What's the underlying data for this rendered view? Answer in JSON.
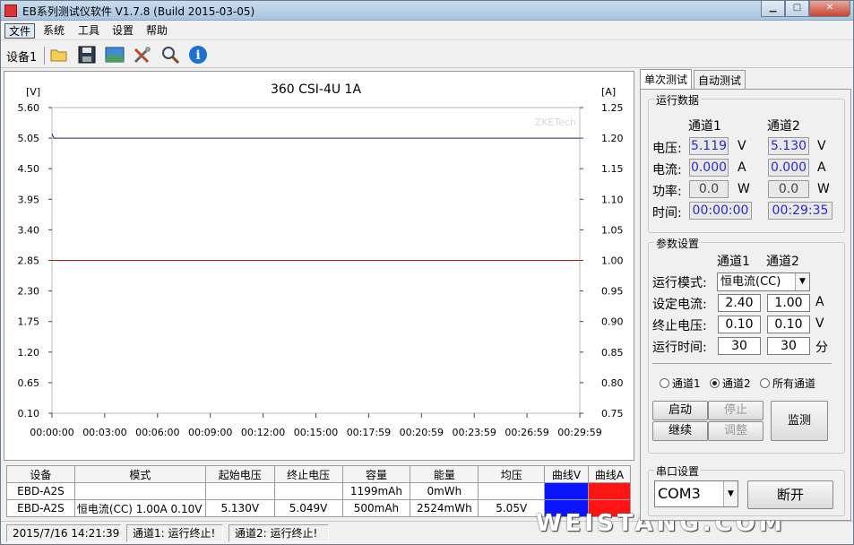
{
  "window": {
    "title": "EB系列测试仪软件 V1.7.8 (Build 2015-03-05)",
    "min_label": "▁",
    "max_label": "□",
    "close_label": "✕"
  },
  "menu": [
    "文件",
    "系统",
    "工具",
    "设置",
    "帮助"
  ],
  "toolbar": {
    "device_tab": "设备1",
    "icons": [
      "folder-icon",
      "save-icon",
      "image-icon",
      "tools-icon",
      "magnifier-icon",
      "info-icon"
    ]
  },
  "chart": {
    "title": "360 CSI-4U 1A",
    "left_unit": "[V]",
    "right_unit": "[A]",
    "left_ticks": [
      "5.60",
      "5.05",
      "4.50",
      "3.95",
      "3.40",
      "2.85",
      "2.30",
      "1.75",
      "1.20",
      "0.65",
      "0.10"
    ],
    "right_ticks": [
      "1.25",
      "1.20",
      "1.15",
      "1.10",
      "1.05",
      "1.00",
      "0.95",
      "0.90",
      "0.85",
      "0.80",
      "0.75"
    ],
    "x_ticks": [
      "00:00:00",
      "00:03:00",
      "00:06:00",
      "00:09:00",
      "00:12:00",
      "00:15:00",
      "00:17:59",
      "00:20:59",
      "00:23:59",
      "00:26:59",
      "00:29:59"
    ],
    "watermark": "ZKETech",
    "voltage_color": "#1c1c8c",
    "current_color": "#cc1111"
  },
  "chart_data": {
    "type": "line",
    "title": "360 CSI-4U 1A",
    "x": [
      "00:00:00",
      "00:29:59"
    ],
    "y_left_range": [
      0.1,
      5.6
    ],
    "y_right_range": [
      0.75,
      1.25
    ],
    "series": [
      {
        "axis": "left",
        "unit": "V",
        "values": [
          5.13,
          5.05
        ]
      },
      {
        "axis": "right",
        "unit": "A",
        "values": [
          1.0,
          1.0
        ]
      }
    ]
  },
  "table": {
    "headers": [
      "设备",
      "模式",
      "起始电压",
      "终止电压",
      "容量",
      "能量",
      "均压",
      "曲线V",
      "曲线A"
    ],
    "rows": [
      [
        "EBD-A2S",
        "",
        "",
        "",
        "1199mAh",
        "0mWh",
        "",
        "",
        ""
      ],
      [
        "EBD-A2S",
        "恒电流(CC)  1.00A  0.10V",
        "5.130V",
        "5.049V",
        "500mAh",
        "2524mWh",
        "5.05V",
        "",
        ""
      ]
    ],
    "curve_v_color": "#0a14ff",
    "curve_a_color": "#ff1414"
  },
  "status": {
    "time": "2015/7/16 14:21:39",
    "ch1": "通道1: 运行终止!",
    "ch2": "通道2: 运行终止!"
  },
  "watermark": "WEISTANG.COM",
  "right": {
    "tabs": [
      "单次测试",
      "自动测试"
    ],
    "run_data": {
      "title": "运行数据",
      "ch1": "通道1",
      "ch2": "通道2",
      "rows": [
        {
          "label": "电压:",
          "v1": "5.119",
          "v2": "5.130",
          "unit": "V"
        },
        {
          "label": "电流:",
          "v1": "0.000",
          "v2": "0.000",
          "unit": "A"
        },
        {
          "label": "功率:",
          "v1": "0.0",
          "v2": "0.0",
          "unit": "W"
        },
        {
          "label": "时间:",
          "v1": "00:00:00",
          "v2": "00:29:35",
          "unit": ""
        }
      ]
    },
    "params": {
      "title": "参数设置",
      "ch1": "通道1",
      "ch2": "通道2",
      "mode_label": "运行模式:",
      "mode_value": "恒电流(CC)",
      "current_label": "设定电流:",
      "current_v1": "2.40",
      "current_v2": "1.00",
      "current_unit": "A",
      "cutoff_label": "终止电压:",
      "cutoff_v1": "0.10",
      "cutoff_v2": "0.10",
      "cutoff_unit": "V",
      "time_label": "运行时间:",
      "time_v1": "30",
      "time_v2": "30",
      "time_unit": "分"
    },
    "radios": [
      {
        "label": "通道1",
        "checked": false
      },
      {
        "label": "通道2",
        "checked": true
      },
      {
        "label": "所有通道",
        "checked": false
      }
    ],
    "buttons": {
      "start": "启动",
      "stop": "停止",
      "continue": "继续",
      "adjust": "调整",
      "monitor": "监测"
    },
    "serial": {
      "title": "串口设置",
      "port": "COM3",
      "disconnect": "断开"
    }
  }
}
